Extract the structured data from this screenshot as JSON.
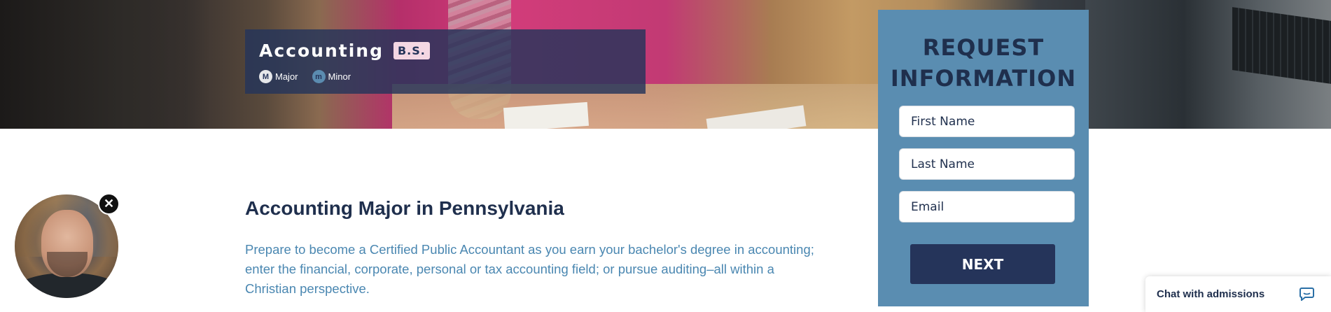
{
  "hero": {
    "program_title": "Accounting",
    "degree_badge": "B.S.",
    "tags": [
      {
        "icon_letter": "M",
        "label": "Major",
        "icon": "major-circle-icon"
      },
      {
        "icon_letter": "m",
        "label": "Minor",
        "icon": "minor-circle-icon"
      }
    ]
  },
  "content": {
    "heading": "Accounting Major in Pennsylvania",
    "body": "Prepare to become a Certified Public Accountant as you earn your bachelor's degree in accounting; enter the financial, corporate, personal or tax accounting field; or pursue auditing–all within a Christian perspective."
  },
  "form": {
    "title_line1": "REQUEST",
    "title_line2": "INFORMATION",
    "first_name_placeholder": "First Name",
    "last_name_placeholder": "Last Name",
    "email_placeholder": "Email",
    "next_label": "NEXT"
  },
  "video_bubble": {
    "close_glyph": "✕"
  },
  "chat": {
    "label": "Chat with admissions",
    "icon": "chat-bubble-icon"
  },
  "colors": {
    "navy": "#25345a",
    "form_blue": "#5a8db1",
    "body_text_blue": "#4a87b1",
    "badge_pink": "#f4d7e3"
  }
}
